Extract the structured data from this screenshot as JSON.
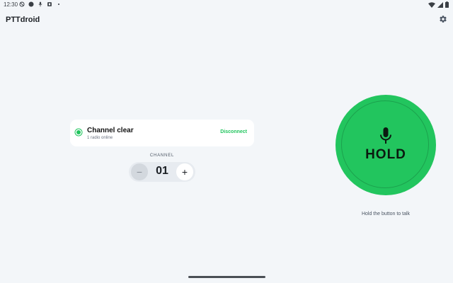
{
  "status_bar": {
    "time": "12:30"
  },
  "app": {
    "title": "PTTdroid"
  },
  "status_card": {
    "title": "Channel clear",
    "subtitle": "1 radio online",
    "action_label": "Disconnect"
  },
  "channel": {
    "label": "CHANNEL",
    "value": "01",
    "decrement_symbol": "−",
    "increment_symbol": "+"
  },
  "ptt": {
    "label": "HOLD",
    "hint": "Hold the button to talk"
  },
  "colors": {
    "accent": "#22c55e",
    "background": "#f3f6f9",
    "card": "#ffffff"
  },
  "icons": [
    "settings-gear-icon",
    "microphone-icon",
    "wifi-icon",
    "signal-icon",
    "battery-icon"
  ]
}
